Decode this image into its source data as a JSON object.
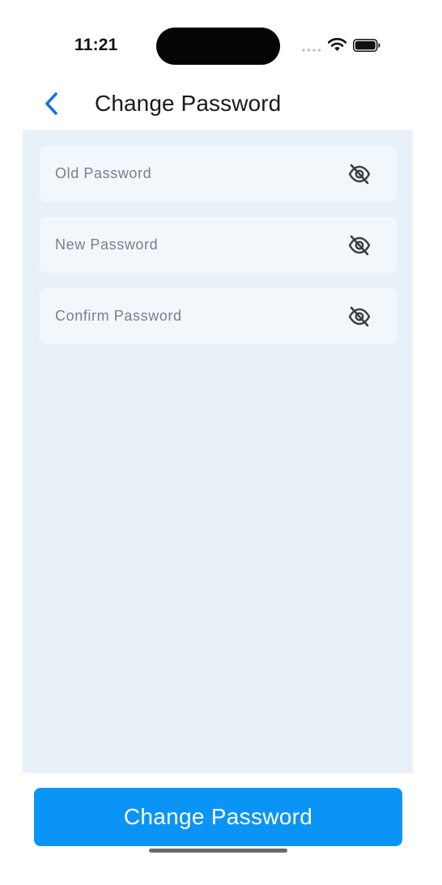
{
  "status_bar": {
    "time": "11:21",
    "icons": [
      "signal-dots-icon",
      "wifi-icon",
      "battery-icon"
    ]
  },
  "nav": {
    "back_icon": "chevron-left-icon",
    "title": "Change Password"
  },
  "form": {
    "fields": [
      {
        "placeholder": "Old Password",
        "value": "",
        "toggle_icon": "eye-off-icon"
      },
      {
        "placeholder": "New Password",
        "value": "",
        "toggle_icon": "eye-off-icon"
      },
      {
        "placeholder": "Confirm Password",
        "value": "",
        "toggle_icon": "eye-off-icon"
      }
    ]
  },
  "actions": {
    "submit_label": "Change Password"
  },
  "colors": {
    "accent": "#0a94f6",
    "back_icon": "#1677d6",
    "content_background": "#e9f1f8",
    "field_background": "#f2f7fb"
  }
}
